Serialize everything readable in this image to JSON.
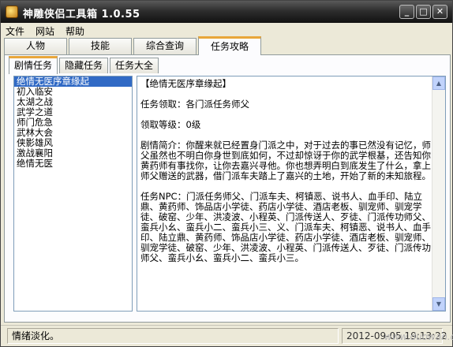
{
  "window": {
    "title": "神雕侠侣工具箱  1.0.55"
  },
  "menu": {
    "items": [
      "文件",
      "网站",
      "帮助"
    ]
  },
  "main_tabs": [
    {
      "label": "人物"
    },
    {
      "label": "技能"
    },
    {
      "label": "综合查询"
    },
    {
      "label": "任务攻略",
      "active": true
    }
  ],
  "sub_tabs": [
    {
      "label": "剧情任务",
      "active": true
    },
    {
      "label": "隐藏任务"
    },
    {
      "label": "任务大全"
    }
  ],
  "quest_list": {
    "items": [
      "绝情无医序章缘起",
      "初入临安",
      "太湖之战",
      "武学之道",
      "师门危急",
      "武林大会",
      "侠影雄风",
      "激战襄阳",
      "绝情无医"
    ],
    "selected_index": 0
  },
  "detail": {
    "heading": "【绝情无医序章缘起】",
    "giver": "任务领取：各门派任务师父",
    "level": "领取等级：0级",
    "summary": "剧情简介：你醒来就已经置身门派之中，对于过去的事已然没有记忆，师父虽然也不明白你身世到底如何，不过却惊讶于你的武学根基，还告知你黄药师有事找你，让你去嘉兴寻他。你也想弄明白到底发生了什么，拿上师父赠送的武器，借门派车夫踏上了嘉兴的土地，开始了新的未知旅程。",
    "npc": "任务NPC：门派任务师父、门派车夫、柯镇恶、说书人、血手印、陆立鼎、黄药师、饰品店小学徒、药店小学徒、酒店老板、驯宠师、驯宠学徒、破窑、少年、洪凌波、小程英、门派传送人、歹徒、门派传功师父、蛮兵小幺、蛮兵小二、蛮兵小三、义、门派车夫、柯镇恶、说书人、血手印、陆立鼎、黄药师、饰品店小学徒、药店小学徒、酒店老板、驯宠师、驯宠学徒、破窑、少年、洪凌波、小程英、门派传送人、歹徒、门派传功师父、蛮兵小幺、蛮兵小二、蛮兵小三。"
  },
  "status": {
    "left": "情绪淡化。",
    "right": "2012-09-05   19:13:22"
  },
  "watermark": "www.duowan.com",
  "colors": {
    "accent_tab": "#e8a63a",
    "selection": "#316ac5",
    "titlebar": "#2e2e2e"
  }
}
